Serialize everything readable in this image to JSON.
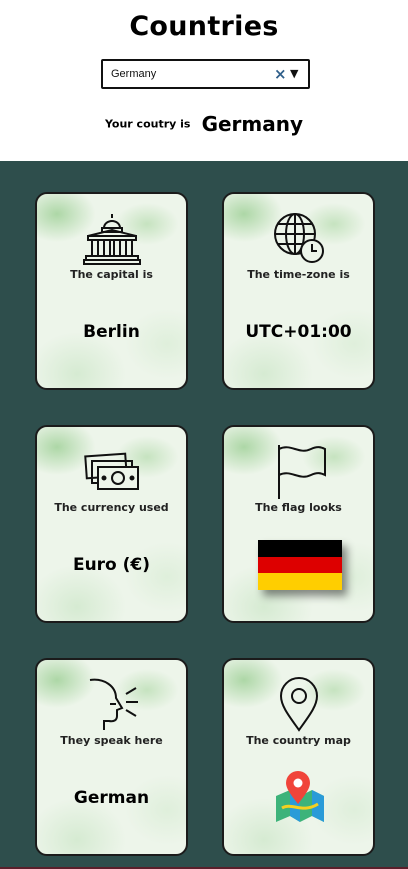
{
  "header": {
    "title": "Countries",
    "select": {
      "value": "Germany",
      "clear_icon": "×",
      "caret_icon": "▼"
    },
    "result": {
      "prefix": "Your coutry is",
      "country": "Germany"
    }
  },
  "cards": {
    "capital": {
      "label": "The capital is",
      "value": "Berlin",
      "icon": "capitol-building-icon"
    },
    "timezone": {
      "label": "The time-zone is",
      "value": "UTC+01:00",
      "icon": "globe-clock-icon"
    },
    "currency": {
      "label": "The currency used",
      "value": "Euro (€)",
      "icon": "banknotes-icon"
    },
    "flag": {
      "label": "The flag looks",
      "icon": "flag-icon",
      "colors": [
        "#000000",
        "#dd0000",
        "#ffce00"
      ]
    },
    "language": {
      "label": "They speak here",
      "value": "German",
      "icon": "speaking-head-icon"
    },
    "map": {
      "label": "The country map",
      "icon": "location-pin-icon",
      "map_icon": "folded-map-pin-icon"
    }
  },
  "colors": {
    "background": "#2e4e4c",
    "card": "#edf5ea",
    "border": "#1b1b1b",
    "clear_icon": "#2f5f8a"
  }
}
